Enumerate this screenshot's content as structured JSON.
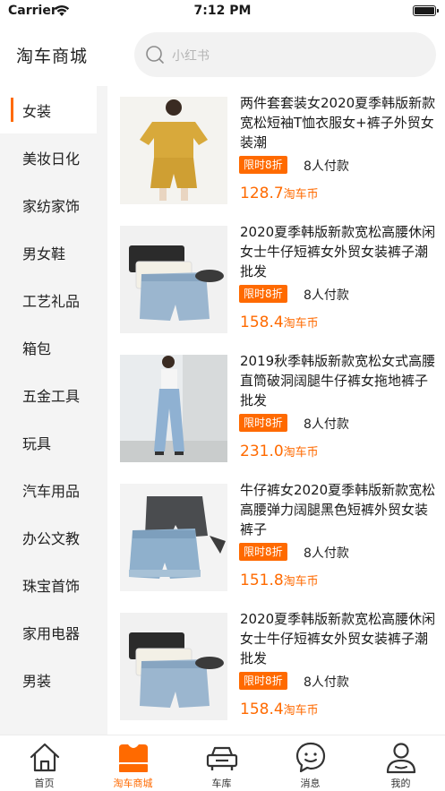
{
  "status_bar": {
    "carrier": "Carrier",
    "time": "7:12 PM"
  },
  "header": {
    "title": "淘车商城",
    "search_placeholder": "小红书"
  },
  "sidebar": {
    "items": [
      {
        "label": "女装",
        "active": true
      },
      {
        "label": "美妆日化"
      },
      {
        "label": "家纺家饰"
      },
      {
        "label": "男女鞋"
      },
      {
        "label": "工艺礼品"
      },
      {
        "label": "箱包"
      },
      {
        "label": "五金工具"
      },
      {
        "label": "玩具"
      },
      {
        "label": "汽车用品"
      },
      {
        "label": "办公文教"
      },
      {
        "label": "珠宝首饰"
      },
      {
        "label": "家用电器"
      },
      {
        "label": "男装"
      }
    ]
  },
  "products": [
    {
      "title": "两件套套装女2020夏季韩版新款宽松短袖T恤衣服女+裤子外贸女装潮",
      "badge": "限时8折",
      "paid": "8人付款",
      "price": "128.7",
      "unit": "淘车币",
      "image": "yellow-tshirt-set"
    },
    {
      "title": "2020夏季韩版新款宽松高腰休闲女士牛仔短裤女外贸女装裤子潮批发",
      "badge": "限时8折",
      "paid": "8人付款",
      "price": "158.4",
      "unit": "淘车币",
      "image": "denim-shorts-stack"
    },
    {
      "title": "2019秋季韩版新款宽松女式高腰直筒破洞阔腿牛仔裤女拖地裤子批发",
      "badge": "限时8折",
      "paid": "8人付款",
      "price": "231.0",
      "unit": "淘车币",
      "image": "wide-leg-jeans-model"
    },
    {
      "title": "牛仔裤女2020夏季韩版新款宽松高腰弹力阔腿黑色短裤外贸女装裤子",
      "badge": "限时8折",
      "paid": "8人付款",
      "price": "151.8",
      "unit": "淘车币",
      "image": "denim-shorts-pair"
    },
    {
      "title": "2020夏季韩版新款宽松高腰休闲女士牛仔短裤女外贸女装裤子潮批发",
      "badge": "限时8折",
      "paid": "8人付款",
      "price": "158.4",
      "unit": "淘车币",
      "image": "denim-shorts-stack"
    }
  ],
  "tabs": [
    {
      "label": "首页",
      "icon": "home-icon"
    },
    {
      "label": "淘车商城",
      "icon": "shop-icon",
      "active": true
    },
    {
      "label": "车库",
      "icon": "car-icon"
    },
    {
      "label": "消息",
      "icon": "message-icon"
    },
    {
      "label": "我的",
      "icon": "profile-icon"
    }
  ],
  "colors": {
    "accent": "#ff6a00",
    "sidebar_bg": "#f4f4f4",
    "search_bg": "#f2f2f2"
  }
}
